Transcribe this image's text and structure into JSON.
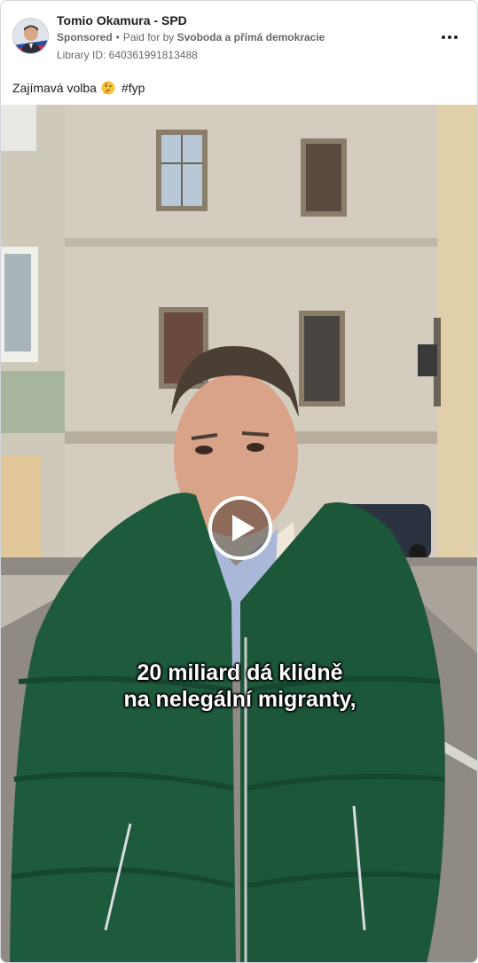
{
  "post": {
    "page_name": "Tomio Okamura - SPD",
    "sponsored_label": "Sponsored",
    "separator": "•",
    "paid_prefix": "Paid for by",
    "payer": "Svoboda a přímá demokracie",
    "library_id": "Library ID: 640361991813488",
    "caption_before": "Zajímavá volba",
    "caption_emoji": "thinking-face-emoji",
    "caption_after": "#fyp"
  },
  "video": {
    "subtitle_line_1": "20 miliard dá klidně",
    "subtitle_line_2": "na nelegální migranty,"
  },
  "icons": {
    "more": "more-options-icon",
    "play": "play-icon"
  },
  "colors": {
    "text_primary": "#1c1e21",
    "text_secondary": "#65676b",
    "border": "#d3d6db",
    "jacket": "#1e5a3c"
  }
}
